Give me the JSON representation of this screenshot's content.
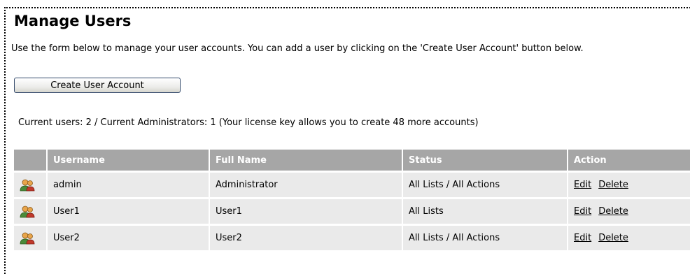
{
  "page": {
    "title": "Manage Users",
    "intro": "Use the form below to manage your user accounts. You can add a user by clicking on the 'Create User Account' button below.",
    "create_button": "Create User Account",
    "counts": "Current users: 2 / Current Administrators: 1 (Your license key allows you to create 48 more accounts)"
  },
  "table": {
    "headers": {
      "username": "Username",
      "full_name": "Full Name",
      "status": "Status",
      "action": "Action"
    },
    "rows": [
      {
        "icon": "users-icon",
        "username": "admin",
        "full_name": "Administrator",
        "status": "All Lists / All Actions",
        "edit": "Edit",
        "delete": "Delete"
      },
      {
        "icon": "users-icon",
        "username": "User1",
        "full_name": "User1",
        "status": "All Lists",
        "edit": "Edit",
        "delete": "Delete"
      },
      {
        "icon": "users-icon",
        "username": "User2",
        "full_name": "User2",
        "status": "All Lists / All Actions",
        "edit": "Edit",
        "delete": "Delete"
      }
    ]
  },
  "colors": {
    "header_bg": "#a6a6a6",
    "row_bg": "#eaeaea",
    "button_border": "#33496b"
  }
}
